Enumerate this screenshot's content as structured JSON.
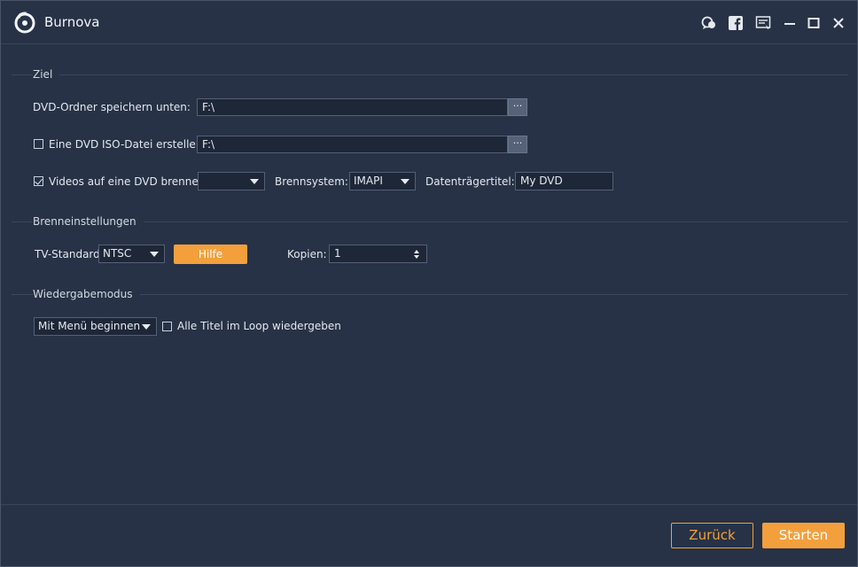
{
  "app": {
    "title": "Burnova"
  },
  "titlebar": {
    "icons": [
      "chat-icon",
      "facebook-icon",
      "feedback-icon",
      "minimize-icon",
      "maximize-icon",
      "close-icon"
    ]
  },
  "ziel": {
    "section_label": "Ziel",
    "dvd_folder_label": "DVD-Ordner speichern unten:",
    "dvd_folder_value": "F:\\",
    "iso_label": "Eine DVD ISO-Datei erstellen",
    "iso_value": "F:\\",
    "iso_checked": false,
    "burn_label": "Videos auf eine DVD brennen",
    "burn_checked": true,
    "burn_drive_value": "",
    "brennsystem_label": "Brennsystem:",
    "brennsystem_value": "IMAPI",
    "datentraeger_label": "Datenträgertitel:",
    "datentraeger_value": "My DVD",
    "browse_label": "···"
  },
  "brenneinstellungen": {
    "section_label": "Brenneinstellungen",
    "tv_label": "TV-Standard:",
    "tv_value": "NTSC",
    "hilfe_label": "Hilfe",
    "kopien_label": "Kopien:",
    "kopien_value": "1"
  },
  "wiedergabe": {
    "section_label": "Wiedergabemodus",
    "mode_value": "Mit Menü beginnen",
    "loop_label": "Alle Titel im Loop wiedergeben",
    "loop_checked": false
  },
  "footer": {
    "back_label": "Zurück",
    "start_label": "Starten"
  },
  "colors": {
    "background": "#273246",
    "accent": "#f3a03c",
    "input_bg": "#1e2738"
  }
}
